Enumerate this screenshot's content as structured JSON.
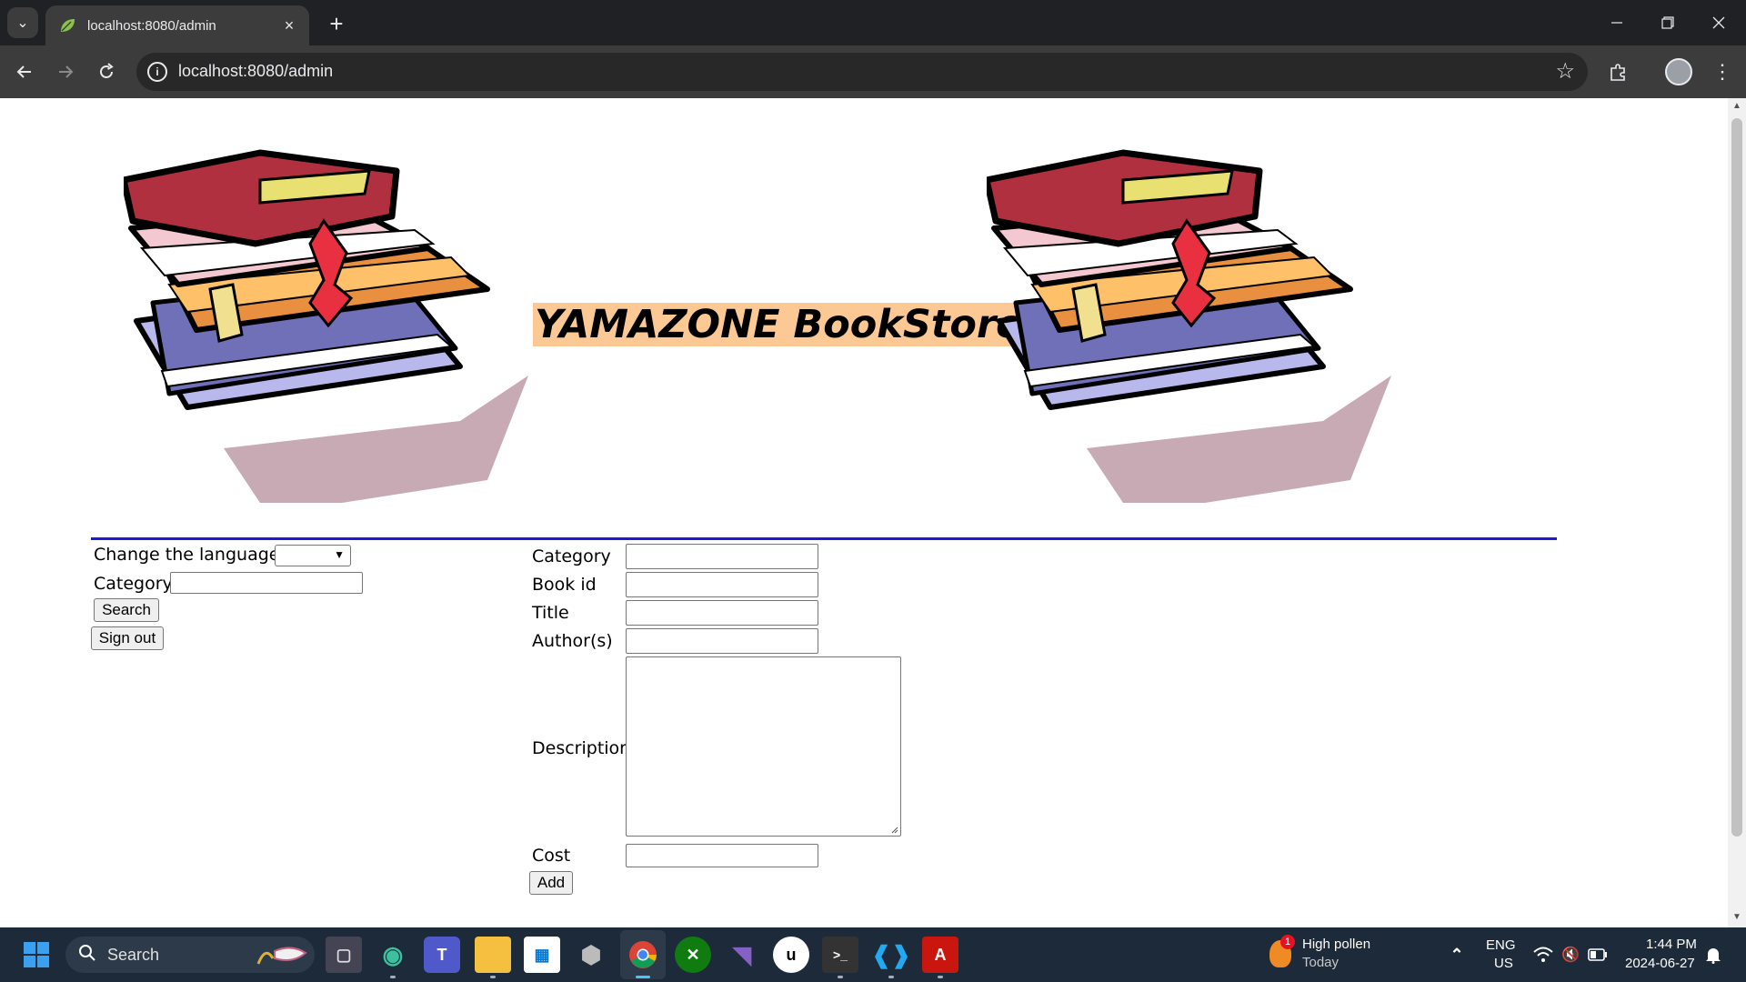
{
  "browser": {
    "tab_title": "localhost:8080/admin",
    "url": "localhost:8080/admin",
    "new_tab_symbol": "+",
    "close_symbol": "×"
  },
  "page": {
    "store_title": "YAMAZONE BookStore",
    "colors": {
      "title_highlight": "#fcc995",
      "divider": "#1a1ad6",
      "book_red": "#b03040",
      "book_orange": "#e89040",
      "book_purple": "#7070b8"
    },
    "sidebar": {
      "language_label": "Change the language:",
      "language_value": "",
      "category_label": "Category",
      "category_value": "",
      "search_button": "Search",
      "signout_button": "Sign out"
    },
    "form": {
      "category_label": "Category",
      "bookid_label": "Book id",
      "title_label": "Title",
      "authors_label": "Author(s)",
      "description_label": "Description",
      "cost_label": "Cost",
      "add_button": "Add",
      "category_value": "",
      "bookid_value": "",
      "title_value": "",
      "authors_value": "",
      "description_value": "",
      "cost_value": ""
    }
  },
  "taskbar": {
    "search_text": "Search",
    "weather_title": "High pollen",
    "weather_sub": "Today",
    "weather_badge": "1",
    "lang_line1": "ENG",
    "lang_line2": "US",
    "time": "1:44 PM",
    "date": "2024-06-27"
  }
}
